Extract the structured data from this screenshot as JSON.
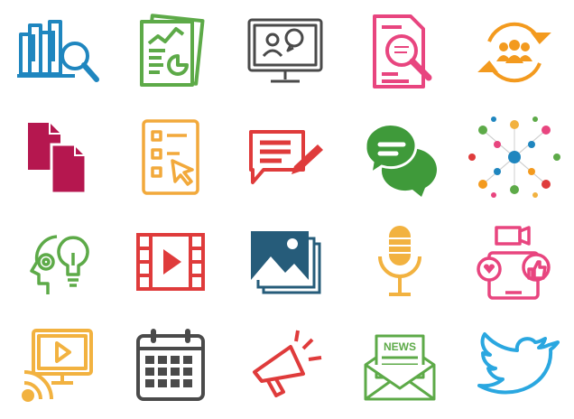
{
  "colors": {
    "blue": "#1f86bf",
    "green": "#5daa48",
    "gray": "#4a4a4a",
    "pink": "#e8457f",
    "orange": "#f39a1e",
    "magenta": "#b5174f",
    "amber": "#f2a93b",
    "red": "#df3b3b",
    "chatgreen": "#3f9a3a",
    "darkblue": "#265c7a",
    "gold": "#f2b240",
    "twitter": "#2aa7e0"
  },
  "icons": [
    {
      "name": "library-search-icon"
    },
    {
      "name": "report-charts-icon"
    },
    {
      "name": "video-call-monitor-icon"
    },
    {
      "name": "document-search-icon"
    },
    {
      "name": "group-cycle-icon"
    },
    {
      "name": "documents-icon"
    },
    {
      "name": "checklist-cursor-icon"
    },
    {
      "name": "write-message-icon"
    },
    {
      "name": "chat-bubbles-icon"
    },
    {
      "name": "network-people-icon"
    },
    {
      "name": "idea-brain-icon"
    },
    {
      "name": "video-film-icon"
    },
    {
      "name": "image-gallery-icon"
    },
    {
      "name": "microphone-icon"
    },
    {
      "name": "social-media-phone-icon"
    },
    {
      "name": "video-broadcast-icon"
    },
    {
      "name": "calendar-icon"
    },
    {
      "name": "megaphone-icon"
    },
    {
      "name": "newsletter-icon"
    },
    {
      "name": "twitter-bird-icon"
    }
  ],
  "newsletter": {
    "label": "NEWS"
  }
}
